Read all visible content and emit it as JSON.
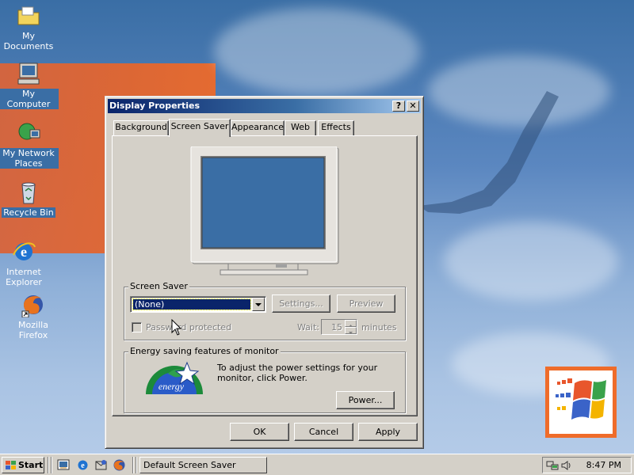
{
  "desktop": {
    "icons": [
      {
        "label": "My Documents"
      },
      {
        "label": "My Computer"
      },
      {
        "label": "My Network Places"
      },
      {
        "label": "Recycle Bin"
      },
      {
        "label": "Internet Explorer"
      },
      {
        "label": "Mozilla Firefox"
      }
    ]
  },
  "window": {
    "title": "Display Properties",
    "help_glyph": "?",
    "close_glyph": "✕",
    "tabs": [
      {
        "label": "Background"
      },
      {
        "label": "Screen Saver"
      },
      {
        "label": "Appearance"
      },
      {
        "label": "Web"
      },
      {
        "label": "Effects"
      }
    ],
    "active_tab": "Screen Saver",
    "screen_saver": {
      "group_label": "Screen Saver",
      "selected": "(None)",
      "settings_label": "Settings...",
      "preview_label": "Preview",
      "password_label": "Password protected",
      "wait_label": "Wait:",
      "wait_value": "15",
      "minutes_label": "minutes"
    },
    "energy": {
      "group_label": "Energy saving features of monitor",
      "text": "To adjust the power settings for your monitor, click Power.",
      "power_label": "Power...",
      "logo_text": "energy"
    },
    "buttons": {
      "ok": "OK",
      "cancel": "Cancel",
      "apply": "Apply"
    }
  },
  "taskbar": {
    "start_label": "Start",
    "task_label": "Default Screen Saver",
    "clock": "8:47 PM"
  },
  "colors": {
    "desktop": "#3a6ea5",
    "titlebar": "#0a246a",
    "face": "#d4d0c8",
    "selection": "#0a246a",
    "monitor_screen": "#3a6ea5"
  }
}
